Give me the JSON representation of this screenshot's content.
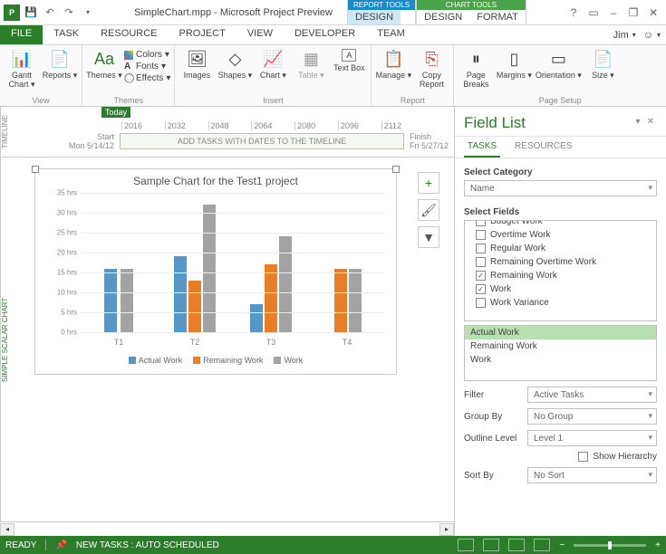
{
  "title": "SimpleChart.mpp - Microsoft Project Preview",
  "context_tabs": {
    "report": {
      "label": "REPORT TOOLS",
      "tab": "DESIGN"
    },
    "chart": {
      "label": "CHART TOOLS",
      "tabs": [
        "DESIGN",
        "FORMAT"
      ]
    }
  },
  "user_name": "Jim",
  "main_tabs": [
    "FILE",
    "TASK",
    "RESOURCE",
    "PROJECT",
    "VIEW",
    "DEVELOPER",
    "TEAM"
  ],
  "ribbon": {
    "view": {
      "label": "View",
      "gantt": "Gantt Chart",
      "reports": "Reports"
    },
    "themes": {
      "label": "Themes",
      "themes": "Themes",
      "colors": "Colors",
      "fonts": "Fonts",
      "effects": "Effects"
    },
    "insert": {
      "label": "Insert",
      "images": "Images",
      "shapes": "Shapes",
      "chart": "Chart",
      "table": "Table",
      "textbox": "Text Box"
    },
    "report": {
      "label": "Report",
      "manage": "Manage",
      "copy": "Copy Report"
    },
    "pagesetup": {
      "label": "Page Setup",
      "breaks": "Page Breaks",
      "margins": "Margins",
      "orientation": "Orientation",
      "size": "Size"
    }
  },
  "timeline": {
    "side_label": "TIMELINE",
    "today": "Today",
    "scale": [
      "2016",
      "2032",
      "2048",
      "2064",
      "2080",
      "2096",
      "2112"
    ],
    "start_label": "Start",
    "start_date": "Mon 5/14/12",
    "finish_label": "Finish",
    "finish_date": "Fri 5/27/12",
    "placeholder": "ADD TASKS WITH DATES TO THE TIMELINE"
  },
  "chart_side_label": "SIMPLE SCALAR CHART",
  "chart_buttons": {
    "plus": "+",
    "brush": "🖌",
    "filter": "▼"
  },
  "field_list": {
    "title": "Field List",
    "tabs": [
      "TASKS",
      "RESOURCES"
    ],
    "select_category": "Select Category",
    "category_value": "Name",
    "select_fields": "Select Fields",
    "checks": [
      {
        "label": "Budget Work",
        "checked": false,
        "clipped": true
      },
      {
        "label": "Overtime Work",
        "checked": false
      },
      {
        "label": "Regular Work",
        "checked": false
      },
      {
        "label": "Remaining Overtime Work",
        "checked": false
      },
      {
        "label": "Remaining Work",
        "checked": true
      },
      {
        "label": "Work",
        "checked": true
      },
      {
        "label": "Work Variance",
        "checked": false
      }
    ],
    "selected_fields": [
      "Actual Work",
      "Remaining Work",
      "Work"
    ],
    "filter": {
      "label": "Filter",
      "value": "Active Tasks"
    },
    "group_by": {
      "label": "Group By",
      "value": "No Group"
    },
    "outline_level": {
      "label": "Outline Level",
      "value": "Level 1"
    },
    "show_hierarchy": "Show Hierarchy",
    "sort_by": {
      "label": "Sort By",
      "value": "No Sort"
    }
  },
  "status": {
    "ready": "READY",
    "schedule_mode": "NEW TASKS : AUTO SCHEDULED"
  },
  "chart_data": {
    "type": "bar",
    "title": "Sample Chart for the Test1 project",
    "categories": [
      "T1",
      "T2",
      "T3",
      "T4"
    ],
    "series": [
      {
        "name": "Actual Work",
        "color": "#5597c9",
        "values": [
          16,
          19,
          7,
          0
        ]
      },
      {
        "name": "Remaining Work",
        "color": "#e87e27",
        "values": [
          0,
          13,
          17,
          16
        ]
      },
      {
        "name": "Work",
        "color": "#a3a3a3",
        "values": [
          16,
          32,
          24,
          16
        ]
      }
    ],
    "ylabel_suffix": " hrs",
    "yticks": [
      0,
      5,
      10,
      15,
      20,
      25,
      30,
      35
    ],
    "ylim": [
      0,
      35
    ]
  }
}
